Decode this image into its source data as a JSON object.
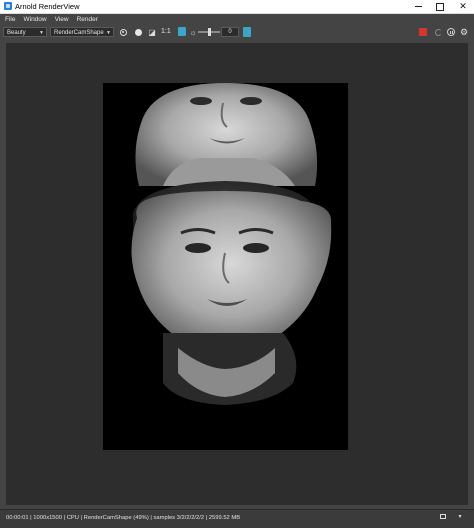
{
  "window": {
    "title": "Arnold RenderView",
    "minimize_icon": "minimize-icon",
    "maximize_icon": "maximize-icon",
    "close_icon": "close-icon",
    "close_glyph": "✕"
  },
  "menu": {
    "items": [
      "File",
      "Window",
      "View",
      "Render"
    ]
  },
  "toolbar": {
    "aov_value": "Beauty",
    "camera_value": "RenderCamShape",
    "ratio_label": "1:1",
    "exposure_value": "0",
    "gear_glyph": "⚙",
    "stop_color": "#d2362f",
    "accent_color": "#3aa6c8"
  },
  "status": {
    "text": "00:00:01 | 1000x1500 | CPU | RenderCamShape (49%) | samples 3/2/2/2/2/2 | 2599.52 MB",
    "dropdown_glyph": "▾"
  }
}
